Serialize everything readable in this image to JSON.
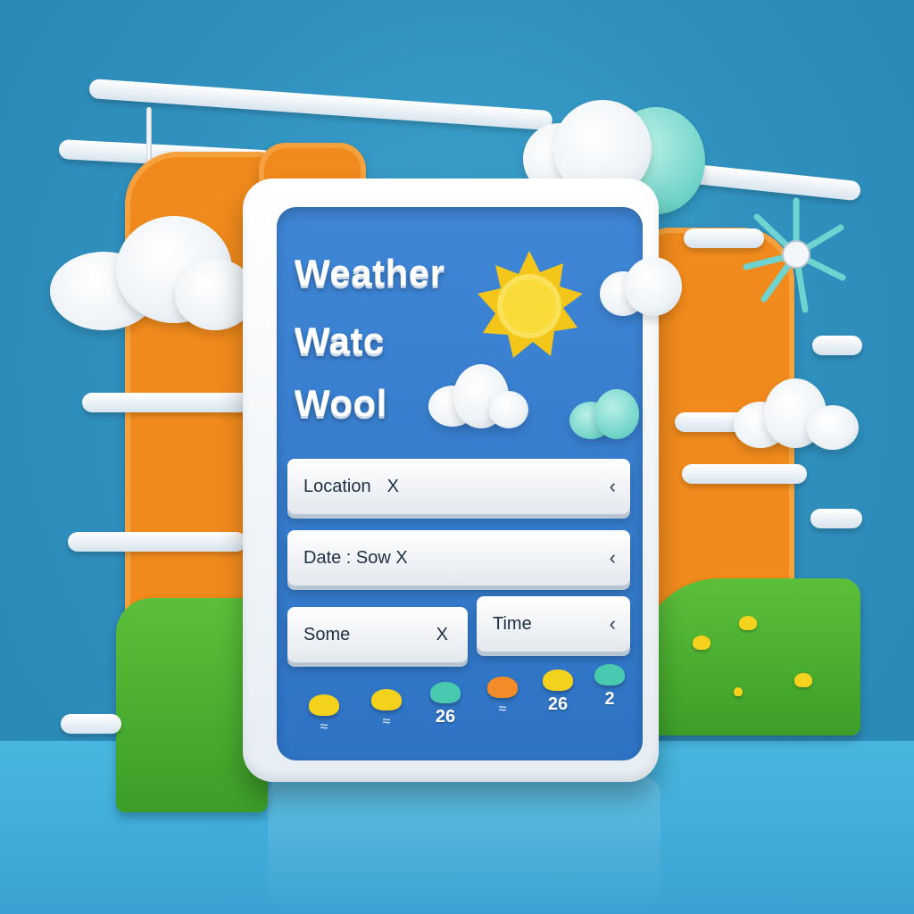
{
  "app": {
    "title_lines": [
      "Weather",
      "Watc",
      "Wool"
    ]
  },
  "form": {
    "location": {
      "label": "Location",
      "clear": "X",
      "chevron": "‹"
    },
    "date": {
      "label": "Date : Sow X",
      "chevron": "‹"
    },
    "some": {
      "label": "Some",
      "clear": "X"
    },
    "time": {
      "label": "Time",
      "chevron": "‹"
    }
  },
  "forecast": [
    {
      "icon": "sun-cloud-icon",
      "color": "#f3d21e",
      "value": "",
      "glyph": "≈"
    },
    {
      "icon": "sun-cloud-icon",
      "color": "#f3d21e",
      "value": "",
      "glyph": "≈"
    },
    {
      "icon": "cloud-icon",
      "color": "#48c9b0",
      "value": "26",
      "glyph": ""
    },
    {
      "icon": "sun-cloud-icon",
      "color": "#f28c28",
      "value": "",
      "glyph": "≈"
    },
    {
      "icon": "sun-cloud-icon",
      "color": "#f3d21e",
      "value": "26",
      "glyph": ""
    },
    {
      "icon": "cloud-icon",
      "color": "#48c9b0",
      "value": "2",
      "glyph": ""
    }
  ],
  "colors": {
    "panel": "#3a80d0",
    "accent_orange": "#f08a1c",
    "accent_green": "#4caf34",
    "sun": "#f7d22a",
    "teal": "#5fcfc2"
  }
}
